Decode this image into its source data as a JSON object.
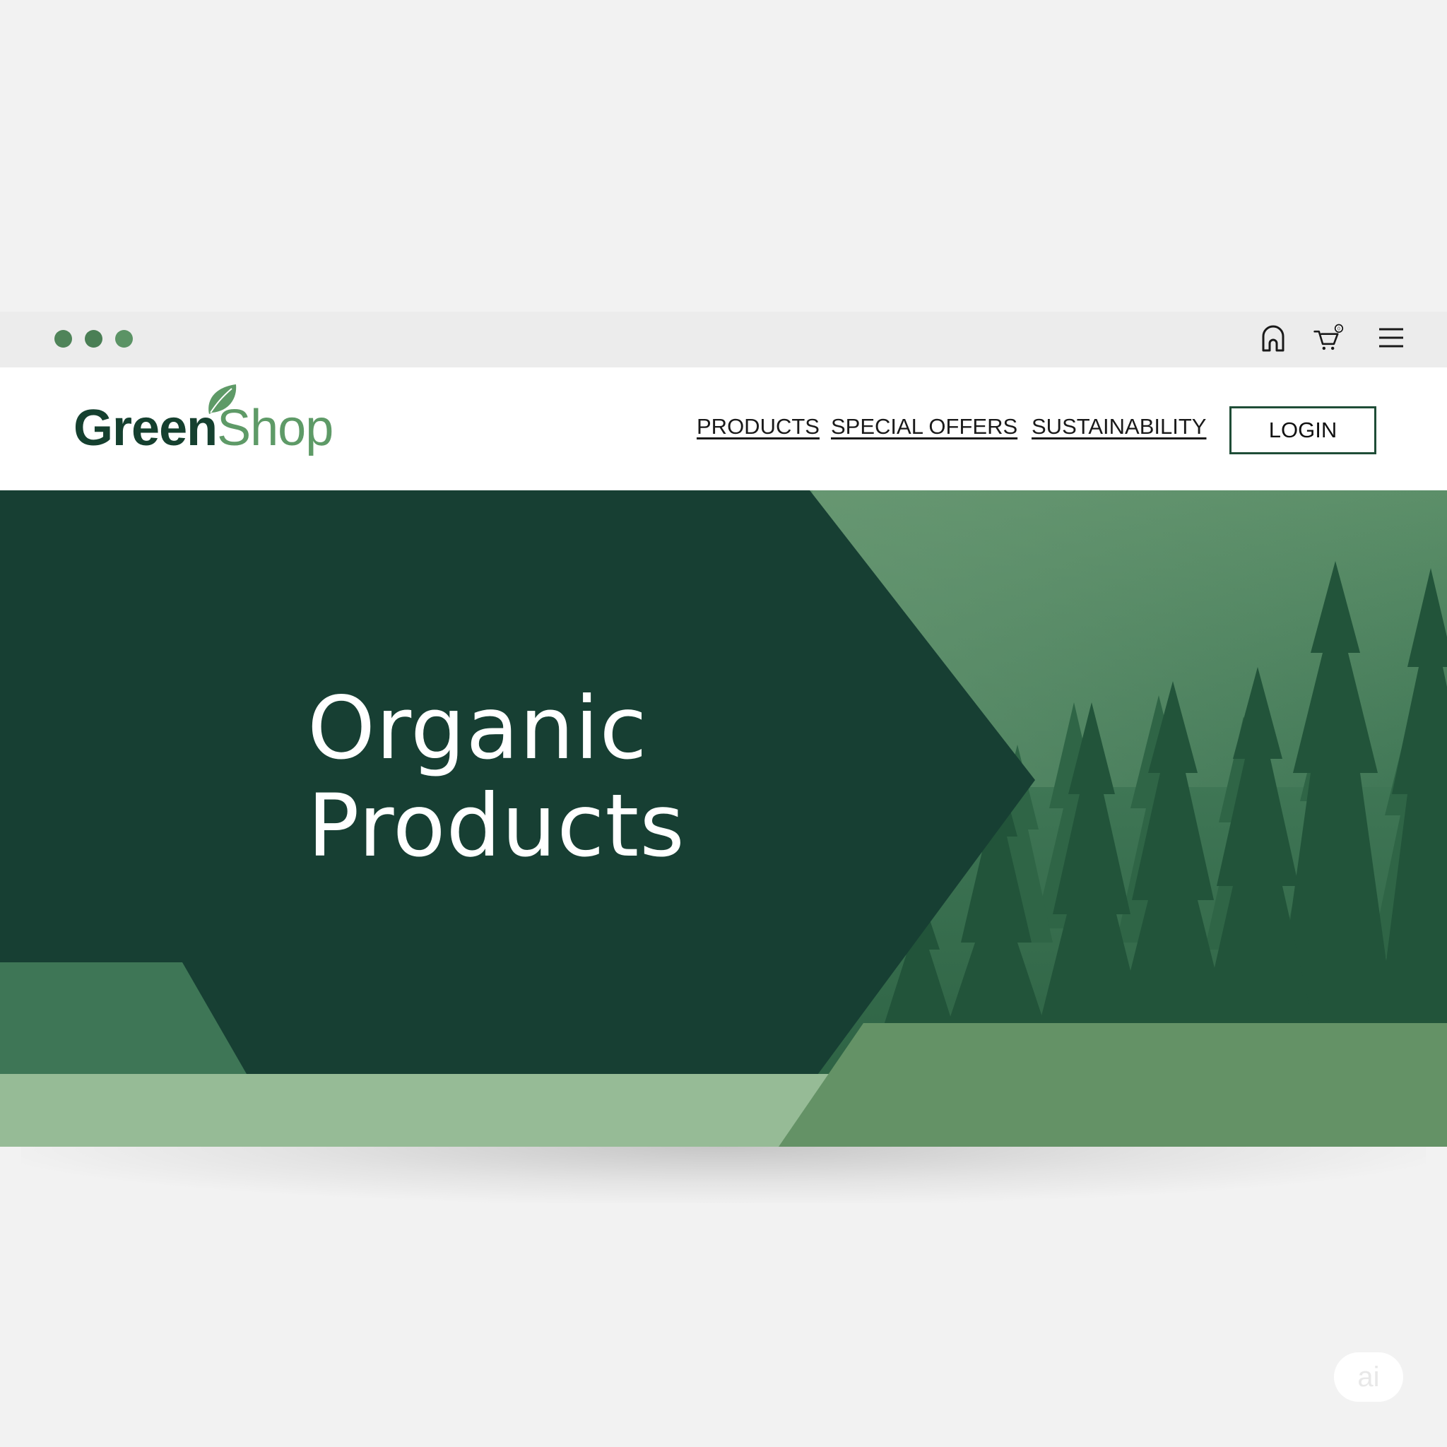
{
  "browser": {
    "window_controls": [
      "dot",
      "dot",
      "dot"
    ],
    "toolbar_icons": [
      "home-icon",
      "cart-icon",
      "menu-icon"
    ],
    "cart_badge": "0"
  },
  "header": {
    "logo": {
      "part1": "Green",
      "part2": "Shop"
    },
    "nav": [
      {
        "label": "PRODUCTS"
      },
      {
        "label": "SPECIAL OFFERS"
      },
      {
        "label": "SUSTAINABILITY"
      }
    ],
    "login_label": "LOGIN"
  },
  "hero": {
    "title_line1": "Organic",
    "title_line2": "Products"
  },
  "colors": {
    "brand_dark": "#173f33",
    "brand_mid": "#3f7655",
    "brand_light": "#96bb96",
    "brand_accent": "#649266",
    "forest": "#2d6446"
  },
  "watermark": "ai"
}
